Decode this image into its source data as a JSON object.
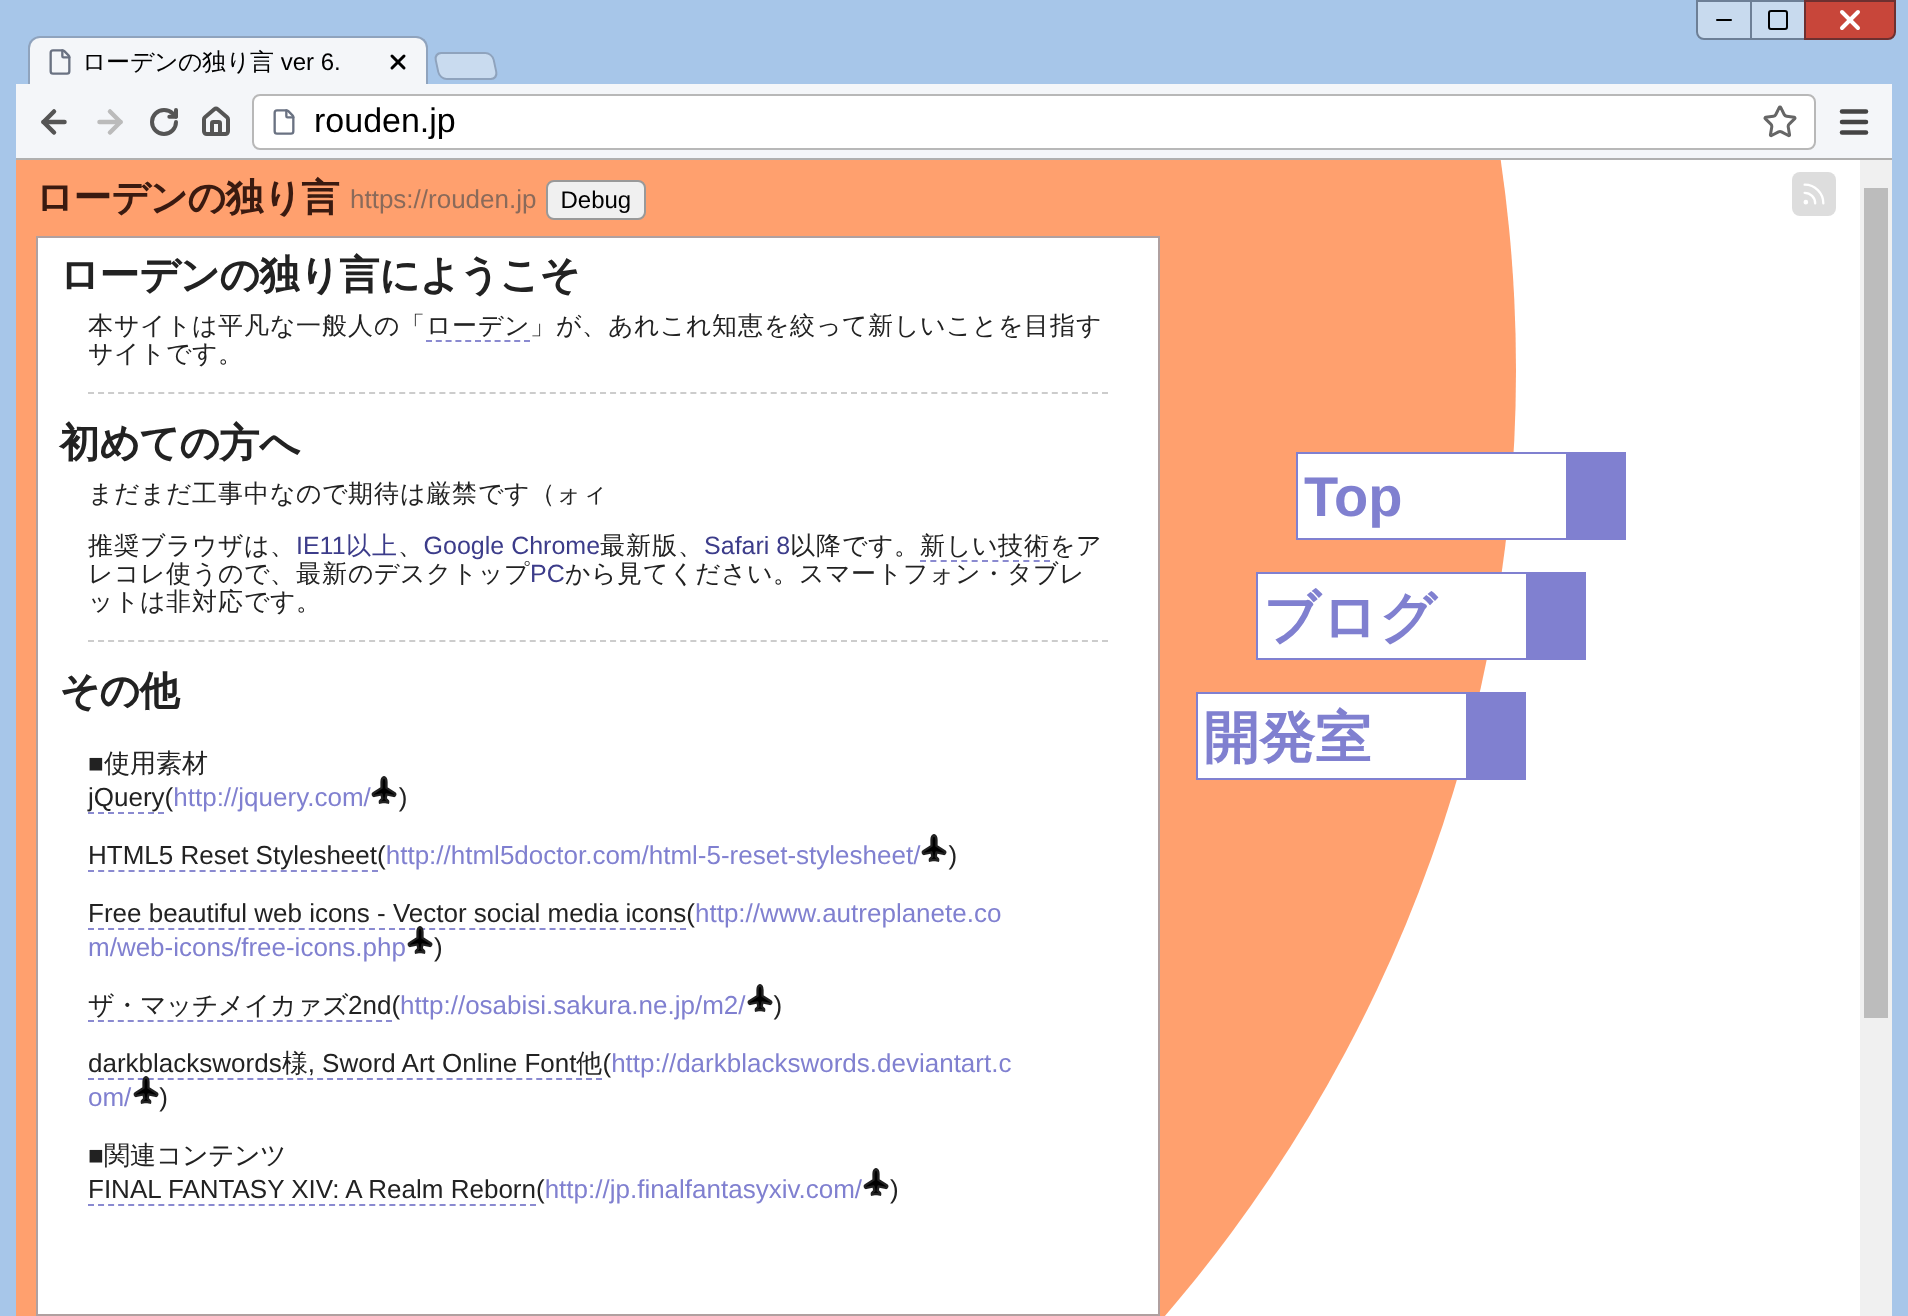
{
  "browser": {
    "tab_title": "ローデンの独り言 ver 6.",
    "address": "rouden.jp"
  },
  "header": {
    "title": "ローデンの独り言",
    "url": "https://rouden.jp",
    "debug_button": "Debug"
  },
  "sections": [
    {
      "heading": "ローデンの独り言にようこそ",
      "paragraphs": [
        [
          {
            "kind": "text",
            "text": "本サイトは平凡な一般人の「"
          },
          {
            "kind": "term",
            "text": "ローデン"
          },
          {
            "kind": "text",
            "text": "」が、あれこれ知恵を絞って新しいことを目指すサイトです。"
          }
        ]
      ],
      "divider": true
    },
    {
      "heading": "初めての方へ",
      "paragraphs": [
        [
          {
            "kind": "text",
            "text": "まだまだ工事中なので期待は厳禁です（ォィ"
          }
        ],
        [
          {
            "kind": "text",
            "text": "推奨ブラウザは、"
          },
          {
            "kind": "highlight",
            "text": "IE11以上"
          },
          {
            "kind": "text",
            "text": "、"
          },
          {
            "kind": "highlight",
            "text": "Google Chrome"
          },
          {
            "kind": "text",
            "text": "最新版、"
          },
          {
            "kind": "highlight",
            "text": "Safari 8"
          },
          {
            "kind": "text",
            "text": "以降です。"
          },
          {
            "kind": "term",
            "text": "新しい技術"
          },
          {
            "kind": "text",
            "text": "をアレコレ使うので、最新のデスクトップ"
          },
          {
            "kind": "highlight",
            "text": "PC"
          },
          {
            "kind": "text",
            "text": "から見てください。スマートフォン・タブレットは非対応です。"
          }
        ]
      ],
      "divider": true
    },
    {
      "heading": "その他",
      "items": [
        {
          "kind": "label",
          "text": "■使用素材"
        },
        {
          "kind": "resource",
          "name": "jQuery",
          "open": "(",
          "url_lines": [
            "http://jquery.com/"
          ],
          "close": ")"
        },
        {
          "kind": "resource",
          "name": "HTML5 Reset Stylesheet",
          "open": "(",
          "url_lines": [
            "http://html5doctor.com/html-5-reset-stylesheet/"
          ],
          "close": ")"
        },
        {
          "kind": "resource",
          "name": "Free beautiful web icons - Vector social media icons",
          "open": "(",
          "url_lines": [
            "http://www.autreplanete.co",
            "m/web-icons/free-icons.php"
          ],
          "close": ")"
        },
        {
          "kind": "resource",
          "name": "ザ・マッチメイカァズ2nd",
          "open": "(",
          "url_lines": [
            "http://osabisi.sakura.ne.jp/m2/"
          ],
          "close": ")"
        },
        {
          "kind": "resource",
          "name": "darkblackswords様, Sword Art Online Font他",
          "open": "(",
          "url_lines": [
            "http://darkblackswords.deviantart.c",
            "om/"
          ],
          "close": ")"
        },
        {
          "kind": "label",
          "text": "■関連コンテンツ"
        },
        {
          "kind": "resource",
          "name": "FINAL FANTASY XIV: A Realm Reborn",
          "open": "(",
          "url_lines": [
            "http://jp.finalfantasyxiv.com/"
          ],
          "close": ")"
        }
      ],
      "divider": false
    }
  ],
  "nav": [
    {
      "label": "Top"
    },
    {
      "label": "ブログ"
    },
    {
      "label": "開発室"
    }
  ]
}
